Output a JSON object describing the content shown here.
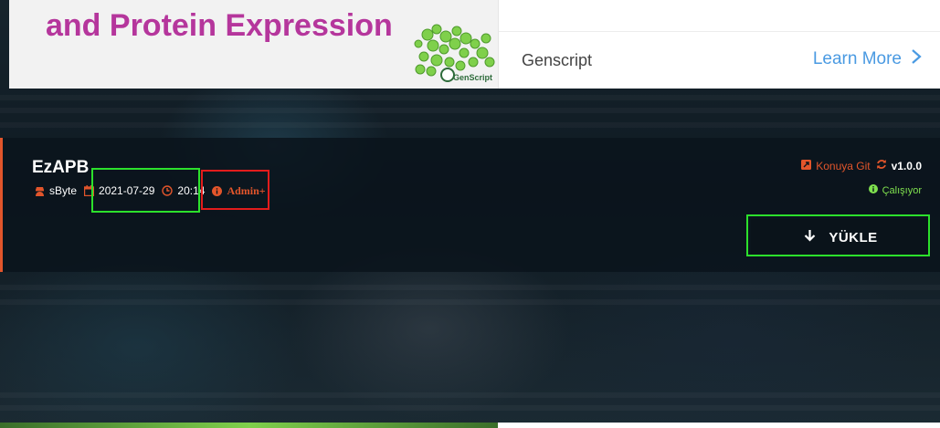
{
  "ad": {
    "headline": "and Protein Expression",
    "logo_text": "GenScript",
    "brand": "Genscript",
    "cta_label": "Learn More",
    "colors": {
      "headline": "#b5369c",
      "cta": "#4a9ae2"
    }
  },
  "plugin": {
    "title": "EzAPB",
    "author": "sByte",
    "date": "2021-07-29",
    "time": "20:14",
    "requirement": "Admin+",
    "git_label": "Konuya Git",
    "version": "v1.0.0",
    "status": "Çalışıyor",
    "install_label": "YÜKLE",
    "colors": {
      "accent": "#e2552b",
      "status_ok": "#7fe04e"
    }
  },
  "icons": {
    "author": "user-secret-icon",
    "date": "calendar-icon",
    "time": "clock-icon",
    "requirement": "info-circle-icon",
    "git": "external-link-icon",
    "version": "sync-icon",
    "status": "info-circle-icon",
    "install": "arrow-down-icon",
    "cta": "chevron-right-icon"
  },
  "annotations": {
    "highlight_colors": {
      "green": "#2ce02c",
      "red": "#e21c1c"
    }
  }
}
